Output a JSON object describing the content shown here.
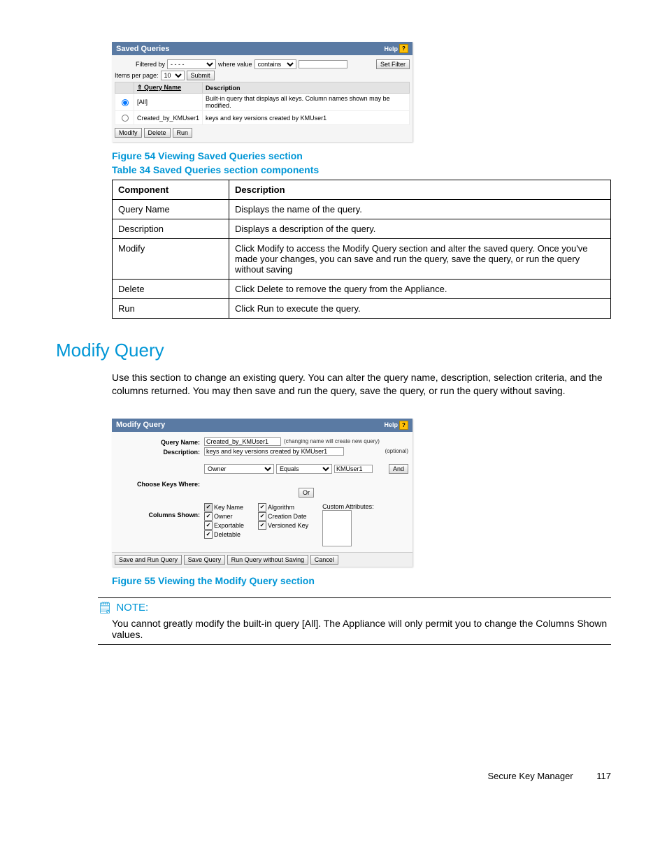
{
  "savedQueriesPanel": {
    "title": "Saved Queries",
    "help": "Help",
    "filteredBy": "Filtered by",
    "filterDash": "- - - -",
    "whereValue": "where value",
    "contains": "contains",
    "setFilter": "Set Filter",
    "itemsPerPage": "Items per page:",
    "perPageVal": "10",
    "submit": "Submit",
    "colQueryName": "Query Name",
    "colDescription": "Description",
    "row1Name": "[All]",
    "row1Desc": "Built-in query that displays all keys. Column names shown may be modified.",
    "row2Name": "Created_by_KMUser1",
    "row2Desc": "keys and key versions created by KMUser1",
    "btnModify": "Modify",
    "btnDelete": "Delete",
    "btnRun": "Run"
  },
  "figure54": "Figure 54 Viewing Saved Queries section",
  "table34": "Table 34 Saved Queries section components",
  "componentsTable": {
    "hComponent": "Component",
    "hDescription": "Description",
    "r1c": "Query Name",
    "r1d": "Displays the name of the query.",
    "r2c": "Description",
    "r2d": "Displays a description of the query.",
    "r3c": "Modify",
    "r3d": "Click Modify to access the Modify Query section and alter the saved query. Once you've made your changes, you can save and run the query, save the query, or run the query without saving",
    "r4c": "Delete",
    "r4d": "Click Delete to remove the query from the Appliance.",
    "r5c": "Run",
    "r5d": "Click Run to execute the query."
  },
  "sectionTitle": "Modify Query",
  "sectionBody": "Use this section to change an existing query. You can alter the query name, description, selection criteria, and the columns returned. You may then save and run the query, save the query, or run the query without saving.",
  "modifyPanel": {
    "title": "Modify Query",
    "help": "Help",
    "queryNameLabel": "Query Name:",
    "queryNameVal": "Created_by_KMUser1",
    "queryNameHint": "(changing name will create new query)",
    "descLabel": "Description:",
    "descVal": "keys and key versions created by KMUser1",
    "descHint": "(optional)",
    "chooseLabel": "Choose Keys Where:",
    "field": "Owner",
    "op": "Equals",
    "val": "KMUser1",
    "and": "And",
    "or": "Or",
    "columnsLabel": "Columns Shown:",
    "c1": "Key Name",
    "c2": "Owner",
    "c3": "Exportable",
    "c4": "Deletable",
    "c5": "Algorithm",
    "c6": "Creation Date",
    "c7": "Versioned Key",
    "customAttr": "Custom Attributes:",
    "btnSaveRun": "Save and Run Query",
    "btnSave": "Save Query",
    "btnRunNoSave": "Run Query without Saving",
    "btnCancel": "Cancel"
  },
  "figure55": "Figure 55 Viewing the Modify Query section",
  "note": {
    "title": "NOTE:",
    "body": "You cannot greatly modify the built-in query [All]. The Appliance will only permit you to change the Columns Shown values."
  },
  "footer": {
    "product": "Secure Key Manager",
    "page": "117"
  }
}
